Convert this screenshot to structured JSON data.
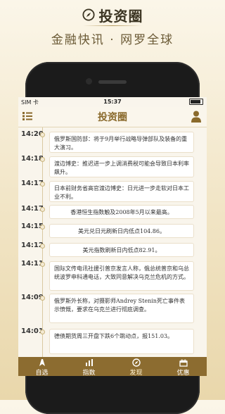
{
  "promo": {
    "title": "投资圈",
    "slogan": "金融快讯 · 网罗全球"
  },
  "status_bar": {
    "carrier": "SIM 卡",
    "time": "15:37"
  },
  "nav": {
    "title": "投资圈"
  },
  "feed": [
    {
      "time": "14:20",
      "text": "俄罗斯国防部：将于9月举行战略导弹部队及装备的重大演习。"
    },
    {
      "time": "14:18",
      "text": "渡边博史：推迟进一步上调消费税可能会导致日本利率飙升。"
    },
    {
      "time": "14:17",
      "text": "日本前财务省高官渡边博史：日元进一步走软对日本工业不利。"
    },
    {
      "time": "14:17",
      "text": "香港恒生指数触及2008年5月以来最高。"
    },
    {
      "time": "14:15",
      "text": "美元兑日元刷新日内低点104.86。"
    },
    {
      "time": "14:12",
      "text": "美元指数刷新日内低点82.91。"
    },
    {
      "time": "14:11",
      "text": "国际文传电讯社援引普京发言人称，俄总统普京和乌总统波罗申科通电话，大致同意解决乌克兰危机的方式。"
    },
    {
      "time": "14:09",
      "text": "俄罗斯外长称，对摄影师Andrey Stenin死亡事件表示愤慨，要求在乌克兰进行彻底调查。"
    },
    {
      "time": "14:01",
      "text": "德债期货周三开盘下跌6个跳动点，报151.03。"
    }
  ],
  "tabs": [
    {
      "label": "自选",
      "icon": "bookmark-icon"
    },
    {
      "label": "指数",
      "icon": "chart-icon"
    },
    {
      "label": "发现",
      "icon": "compass-icon"
    },
    {
      "label": "优惠",
      "icon": "gift-icon"
    }
  ],
  "colors": {
    "accent": "#8c6c30",
    "nav_title": "#8a6a2c",
    "timeline": "#d9c9a1"
  }
}
